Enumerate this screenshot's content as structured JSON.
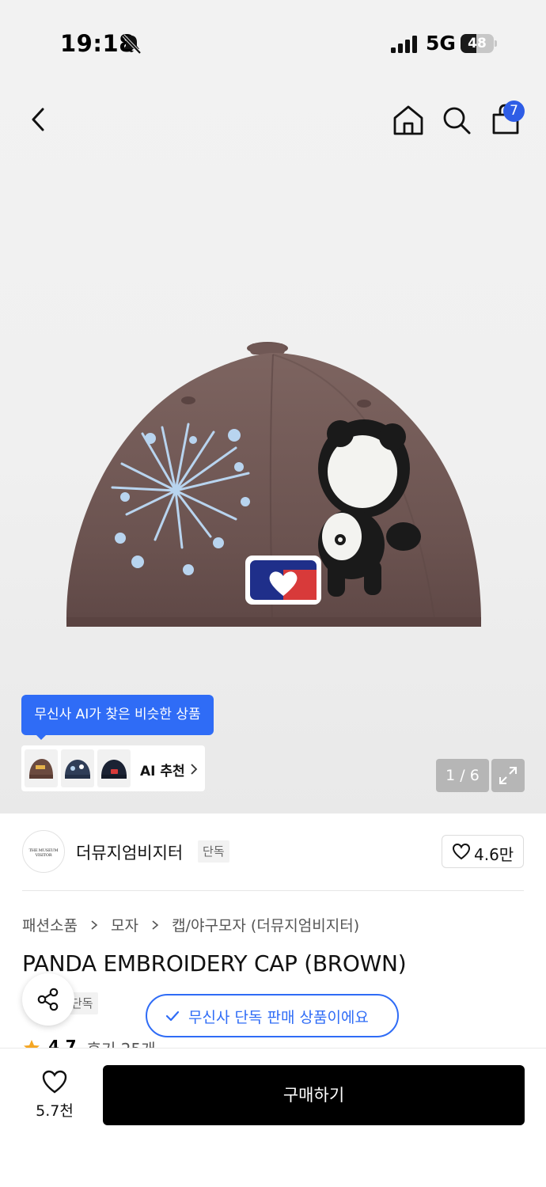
{
  "status_bar": {
    "time": "19:18",
    "network": "5G",
    "battery": "48",
    "battery_level": 0.48
  },
  "header": {
    "back_icon": "chevron-left-icon",
    "home_icon": "home-icon",
    "search_icon": "search-icon",
    "cart_icon": "shopping-bag-icon",
    "cart_badge": "7",
    "badge_color": "#2e5de6"
  },
  "gallery": {
    "counter": "1 / 6",
    "expand_icon": "expand-icon"
  },
  "ai_recommend": {
    "tooltip": "무신사 AI가 찾은 비슷한 상품",
    "label": "AI 추천",
    "accent": "#2f6cf6"
  },
  "brand": {
    "logo_text": "THE MUSEUM VISITOR",
    "name": "더뮤지엄비지터",
    "tag": "단독",
    "likes": "4.6만"
  },
  "breadcrumb": [
    "패션소품",
    "모자",
    "캡/야구모자 (더뮤지엄비지터)"
  ],
  "product": {
    "title": "PANDA EMBROIDERY CAP (BROWN)",
    "exclusive_tag": "단독",
    "exclusive_notice": "무신사 단독 판매 상품이에요",
    "rating": "4.7",
    "reviews": "후기 25개"
  },
  "bottom_bar": {
    "wish_count": "5.7천",
    "buy_label": "구매하기"
  }
}
